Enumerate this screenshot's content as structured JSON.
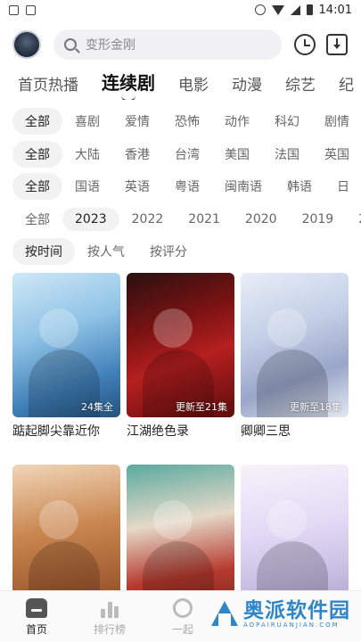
{
  "status": {
    "time": "14:01"
  },
  "search": {
    "placeholder": "变形金刚"
  },
  "category_tabs": [
    {
      "label": "首页热播",
      "active": false
    },
    {
      "label": "连续剧",
      "active": true
    },
    {
      "label": "电影",
      "active": false
    },
    {
      "label": "动漫",
      "active": false
    },
    {
      "label": "综艺",
      "active": false
    },
    {
      "label": "纪",
      "active": false
    }
  ],
  "filters": {
    "genre": [
      "全部",
      "喜剧",
      "爱情",
      "恐怖",
      "动作",
      "科幻",
      "剧情"
    ],
    "region": [
      "全部",
      "大陆",
      "香港",
      "台湾",
      "美国",
      "法国",
      "英国"
    ],
    "language": [
      "全部",
      "国语",
      "英语",
      "粤语",
      "闽南语",
      "韩语",
      "日"
    ],
    "year": [
      "全部",
      "2023",
      "2022",
      "2021",
      "2020",
      "2019",
      "2"
    ],
    "sort": [
      "按时间",
      "按人气",
      "按评分"
    ],
    "selected": {
      "genre": "全部",
      "region": "全部",
      "language": "全部",
      "year": "2023",
      "sort": "按时间"
    }
  },
  "cards": [
    {
      "title": "踮起脚尖靠近你",
      "badge": "24集全",
      "poster_style": "p1",
      "poster_text": "踮起脚尖靠近你"
    },
    {
      "title": "江湖绝色录",
      "badge": "更新至21集",
      "poster_style": "p2",
      "poster_text": "江湖绝色录"
    },
    {
      "title": "卿卿三思",
      "badge": "更新至18集",
      "poster_style": "p3",
      "poster_text": "卿卿三思"
    },
    {
      "title": "",
      "badge": "",
      "poster_style": "p4",
      "poster_text": ""
    },
    {
      "title": "",
      "badge": "",
      "poster_style": "p5",
      "poster_text": ""
    },
    {
      "title": "",
      "badge": "",
      "poster_style": "p6",
      "poster_text": ""
    }
  ],
  "bottom_nav": [
    {
      "label": "首页",
      "icon": "home-icon",
      "active": true
    },
    {
      "label": "排行榜",
      "icon": "ranking-icon",
      "active": false
    },
    {
      "label": "一起",
      "icon": "together-icon",
      "active": false
    }
  ],
  "watermark": {
    "main": "奥派软件园",
    "sub": "AOPAIRUANJIAN.COM"
  },
  "colors": {
    "accent": "#2e86c9",
    "chip_bg": "#f2f2f2",
    "text_dark": "#111111"
  }
}
